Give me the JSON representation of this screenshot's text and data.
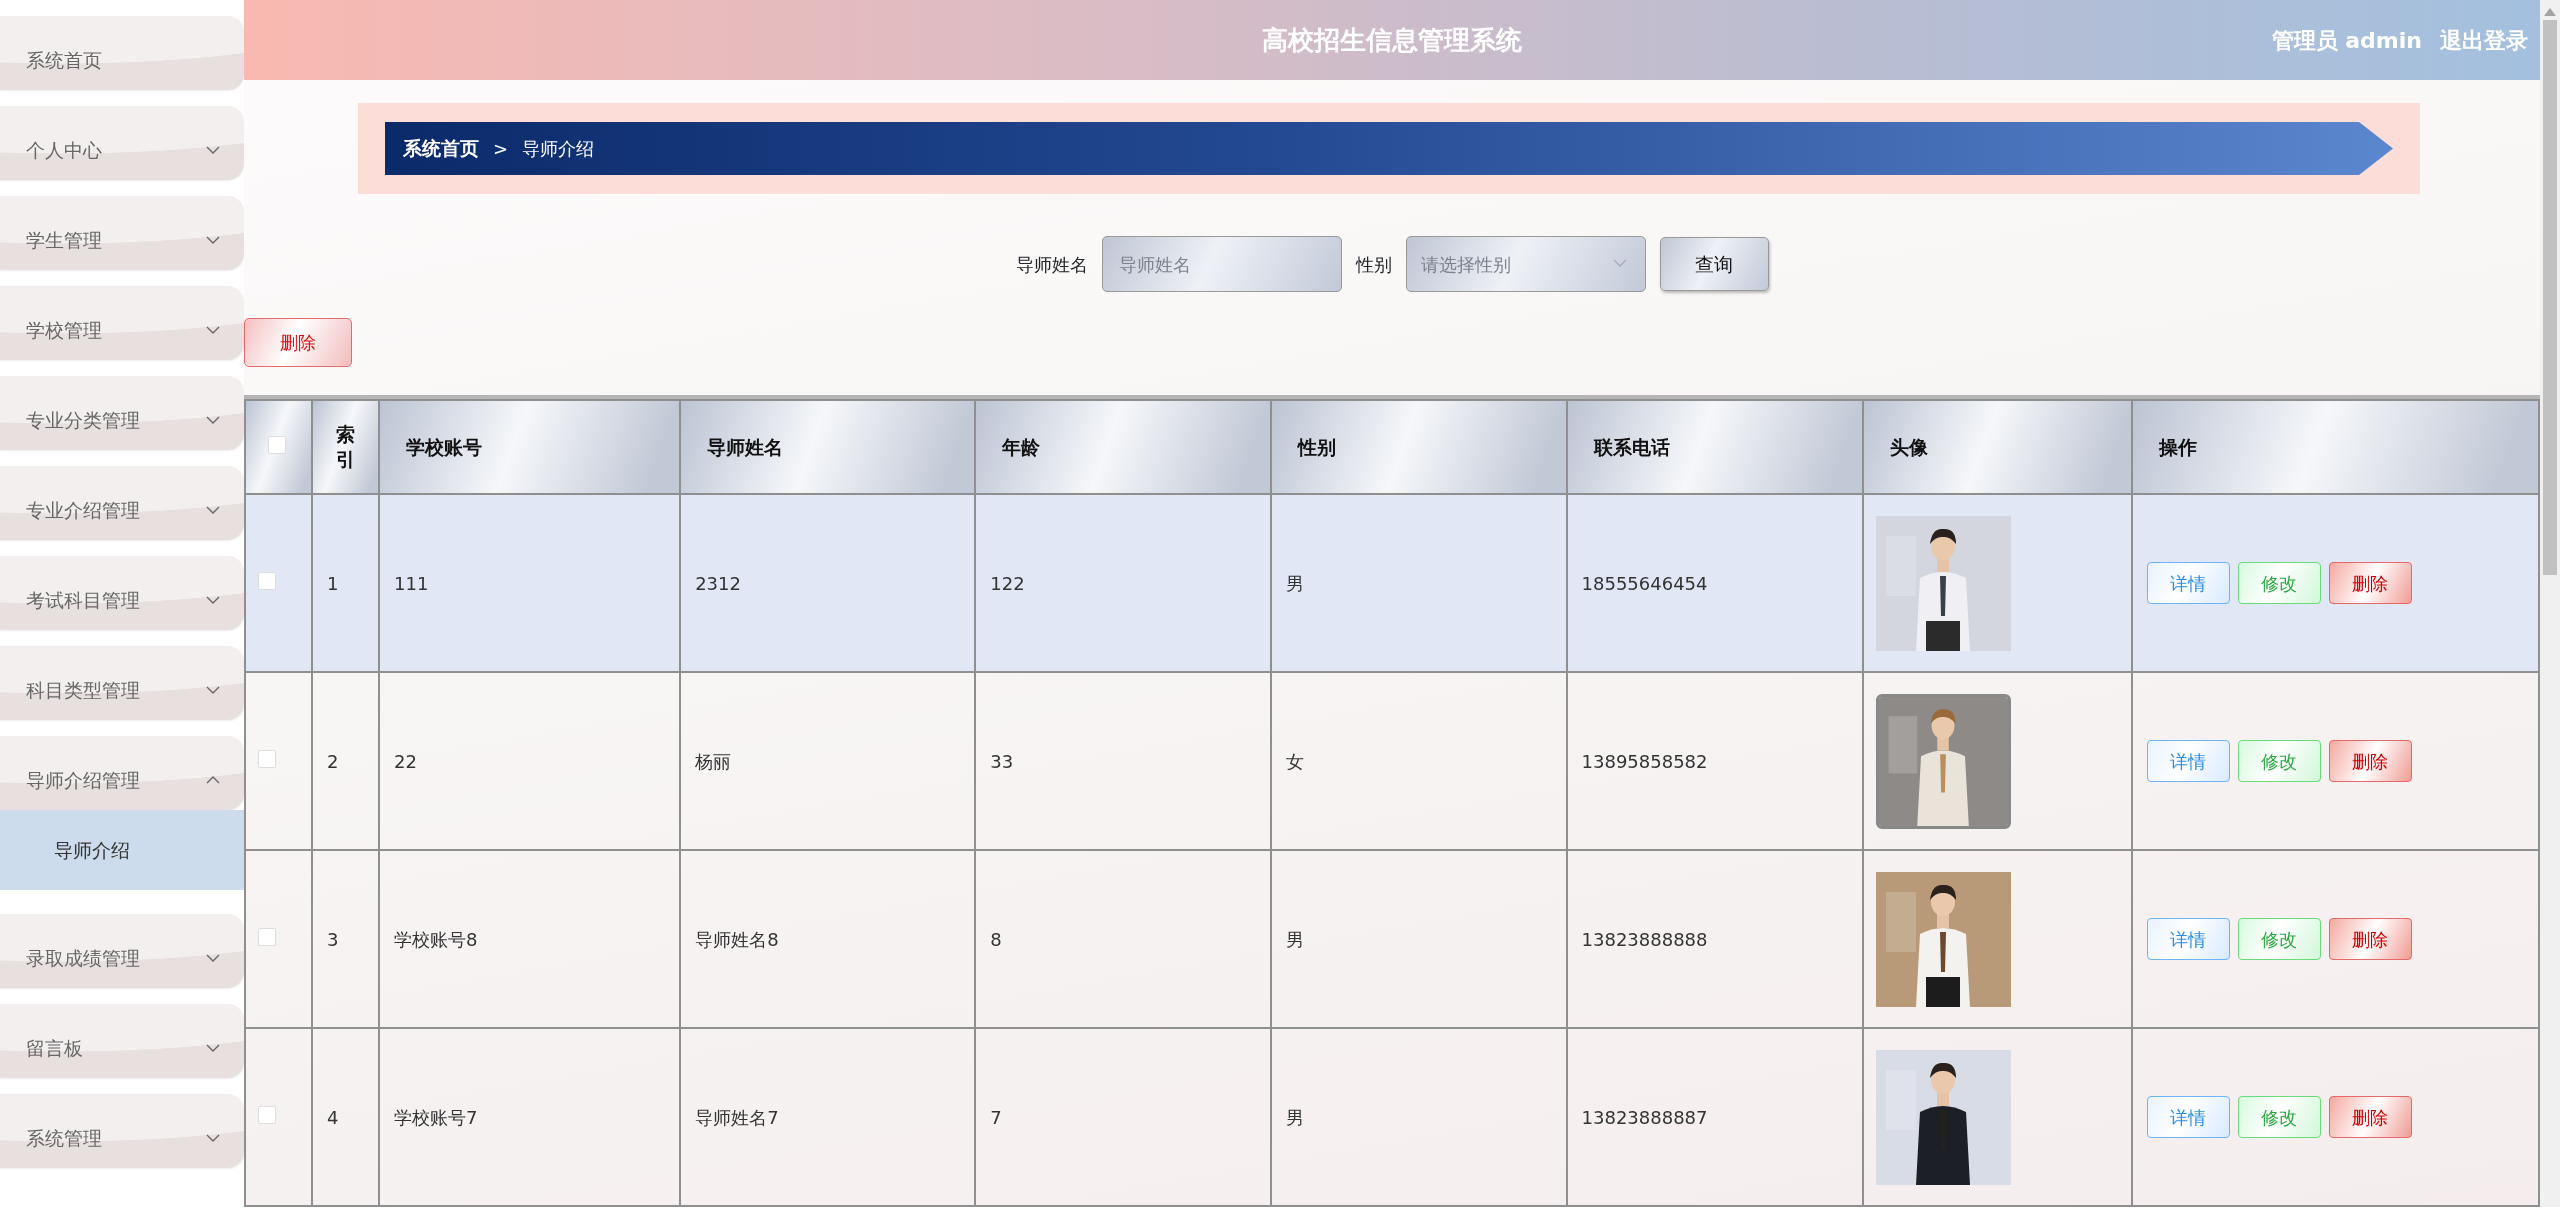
{
  "header": {
    "title": "高校招生信息管理系统",
    "user_label": "管理员 admin",
    "logout": "退出登录"
  },
  "sidebar": {
    "items": [
      {
        "label": "系统首页",
        "expandable": false
      },
      {
        "label": "个人中心",
        "expandable": true,
        "expanded": false
      },
      {
        "label": "学生管理",
        "expandable": true,
        "expanded": false
      },
      {
        "label": "学校管理",
        "expandable": true,
        "expanded": false
      },
      {
        "label": "专业分类管理",
        "expandable": true,
        "expanded": false
      },
      {
        "label": "专业介绍管理",
        "expandable": true,
        "expanded": false
      },
      {
        "label": "考试科目管理",
        "expandable": true,
        "expanded": false
      },
      {
        "label": "科目类型管理",
        "expandable": true,
        "expanded": false
      },
      {
        "label": "导师介绍管理",
        "expandable": true,
        "expanded": true,
        "children": [
          {
            "label": "导师介绍",
            "selected": true
          }
        ]
      },
      {
        "label": "录取成绩管理",
        "expandable": true,
        "expanded": false
      },
      {
        "label": "留言板",
        "expandable": true,
        "expanded": false
      },
      {
        "label": "系统管理",
        "expandable": true,
        "expanded": false
      }
    ]
  },
  "breadcrumb": {
    "items": [
      {
        "label": "系统首页",
        "current": false
      },
      {
        "label": "导师介绍",
        "current": true
      }
    ],
    "separator": ">"
  },
  "search": {
    "fields": [
      {
        "label": "导师姓名",
        "kind": "text",
        "placeholder": "导师姓名"
      },
      {
        "label": "性别",
        "kind": "select",
        "placeholder": "请选择性别"
      }
    ],
    "button": "查询"
  },
  "bulk_delete": "删除",
  "table": {
    "select_all": {
      "checked": false
    },
    "columns": [
      "索引",
      "学校账号",
      "导师姓名",
      "年龄",
      "性别",
      "联系电话",
      "头像",
      "操作"
    ],
    "rows": [
      {
        "checked": false,
        "highlighted": true,
        "cells": [
          "1",
          "111",
          "2312",
          "122",
          "男",
          "18555646454"
        ],
        "avatar": {
          "kind": "picture"
        },
        "actions": [
          {
            "label": "详情",
            "kind": "detail"
          },
          {
            "label": "修改",
            "kind": "edit"
          },
          {
            "label": "删除",
            "kind": "delete"
          }
        ]
      },
      {
        "checked": false,
        "highlighted": false,
        "cells": [
          "2",
          "22",
          "杨丽",
          "33",
          "女",
          "13895858582"
        ],
        "avatar": {
          "kind": "picture"
        },
        "actions": [
          {
            "label": "详情",
            "kind": "detail"
          },
          {
            "label": "修改",
            "kind": "edit"
          },
          {
            "label": "删除",
            "kind": "delete"
          }
        ]
      },
      {
        "checked": false,
        "highlighted": false,
        "cells": [
          "3",
          "学校账号8",
          "导师姓名8",
          "8",
          "男",
          "13823888888"
        ],
        "avatar": {
          "kind": "picture"
        },
        "actions": [
          {
            "label": "详情",
            "kind": "detail"
          },
          {
            "label": "修改",
            "kind": "edit"
          },
          {
            "label": "删除",
            "kind": "delete"
          }
        ]
      },
      {
        "checked": false,
        "highlighted": false,
        "cells": [
          "4",
          "学校账号7",
          "导师姓名7",
          "7",
          "男",
          "13823888887"
        ],
        "avatar": {
          "kind": "picture"
        },
        "actions": [
          {
            "label": "详情",
            "kind": "detail"
          },
          {
            "label": "修改",
            "kind": "edit"
          },
          {
            "label": "删除",
            "kind": "delete"
          }
        ]
      }
    ]
  }
}
